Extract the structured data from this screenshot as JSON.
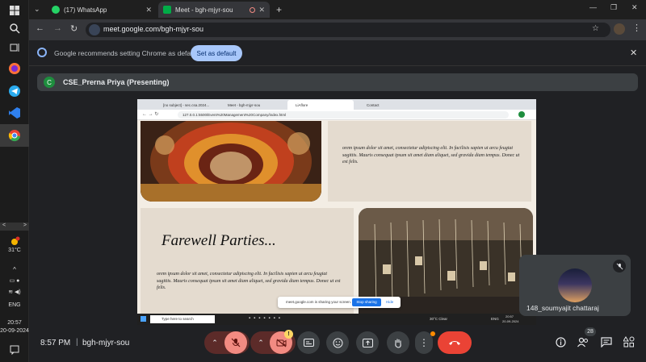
{
  "browser": {
    "tabs": [
      {
        "label": "(17) WhatsApp"
      },
      {
        "label": "Meet - bgh-mjyr-sou"
      }
    ],
    "url": "meet.google.com/bgh-mjyr-sou"
  },
  "infobar": {
    "message": "Google recommends setting Chrome as default",
    "button": "Set as default"
  },
  "presenter": {
    "initial": "C",
    "label": "CSE_Prerna Priya (Presenting)"
  },
  "shared_screen": {
    "tabs": [
      "[no subject] - sec.csa.2024...",
      "Meet - bgh-mjyr-sou",
      "LiAflore",
      "Contact"
    ],
    "url": "127.0.0.1:5500/Event%20Management%20Company/index.html",
    "lorem_top": "orem ipsum dolor sit amet, consectetur adipiscing elit. In facilisis sapien ut arcu feugiat sagittis. Mauris consequat ipsum sit amet diam aliquet, sed gravida diam tempus. Donec ut est felis.",
    "heading": "Farewell Parties...",
    "lorem_bottom": "orem ipsum dolor sit amet, consectetur adipiscing elit. In facilisis sapien ut arcu feugiat sagittis. Mauris consequat ipsum sit amet diam aliquet, sed gravida diam tempus. Donec ut est felis.",
    "sharing_notice": "meet.google.com is sharing your screen.",
    "stop_sharing": "Stop sharing",
    "hide": "Hide",
    "search_placeholder": "Type here to search",
    "weather": "30°C  Clear",
    "lang": "ENG",
    "time": "20:57",
    "date": "20-09-2024"
  },
  "participant": {
    "name": "148_soumyajit chattaraj"
  },
  "taskbar": {
    "temp": "31°C",
    "lang": "ENG",
    "time": "20:57",
    "date": "20-09-2024"
  },
  "meeting": {
    "time": "8:57 PM",
    "code": "bgh-mjyr-sou",
    "participants_count": "28"
  },
  "colors": {
    "accent": "#a8c7fa",
    "end_call": "#ea4335",
    "muted": "#f28b82"
  }
}
